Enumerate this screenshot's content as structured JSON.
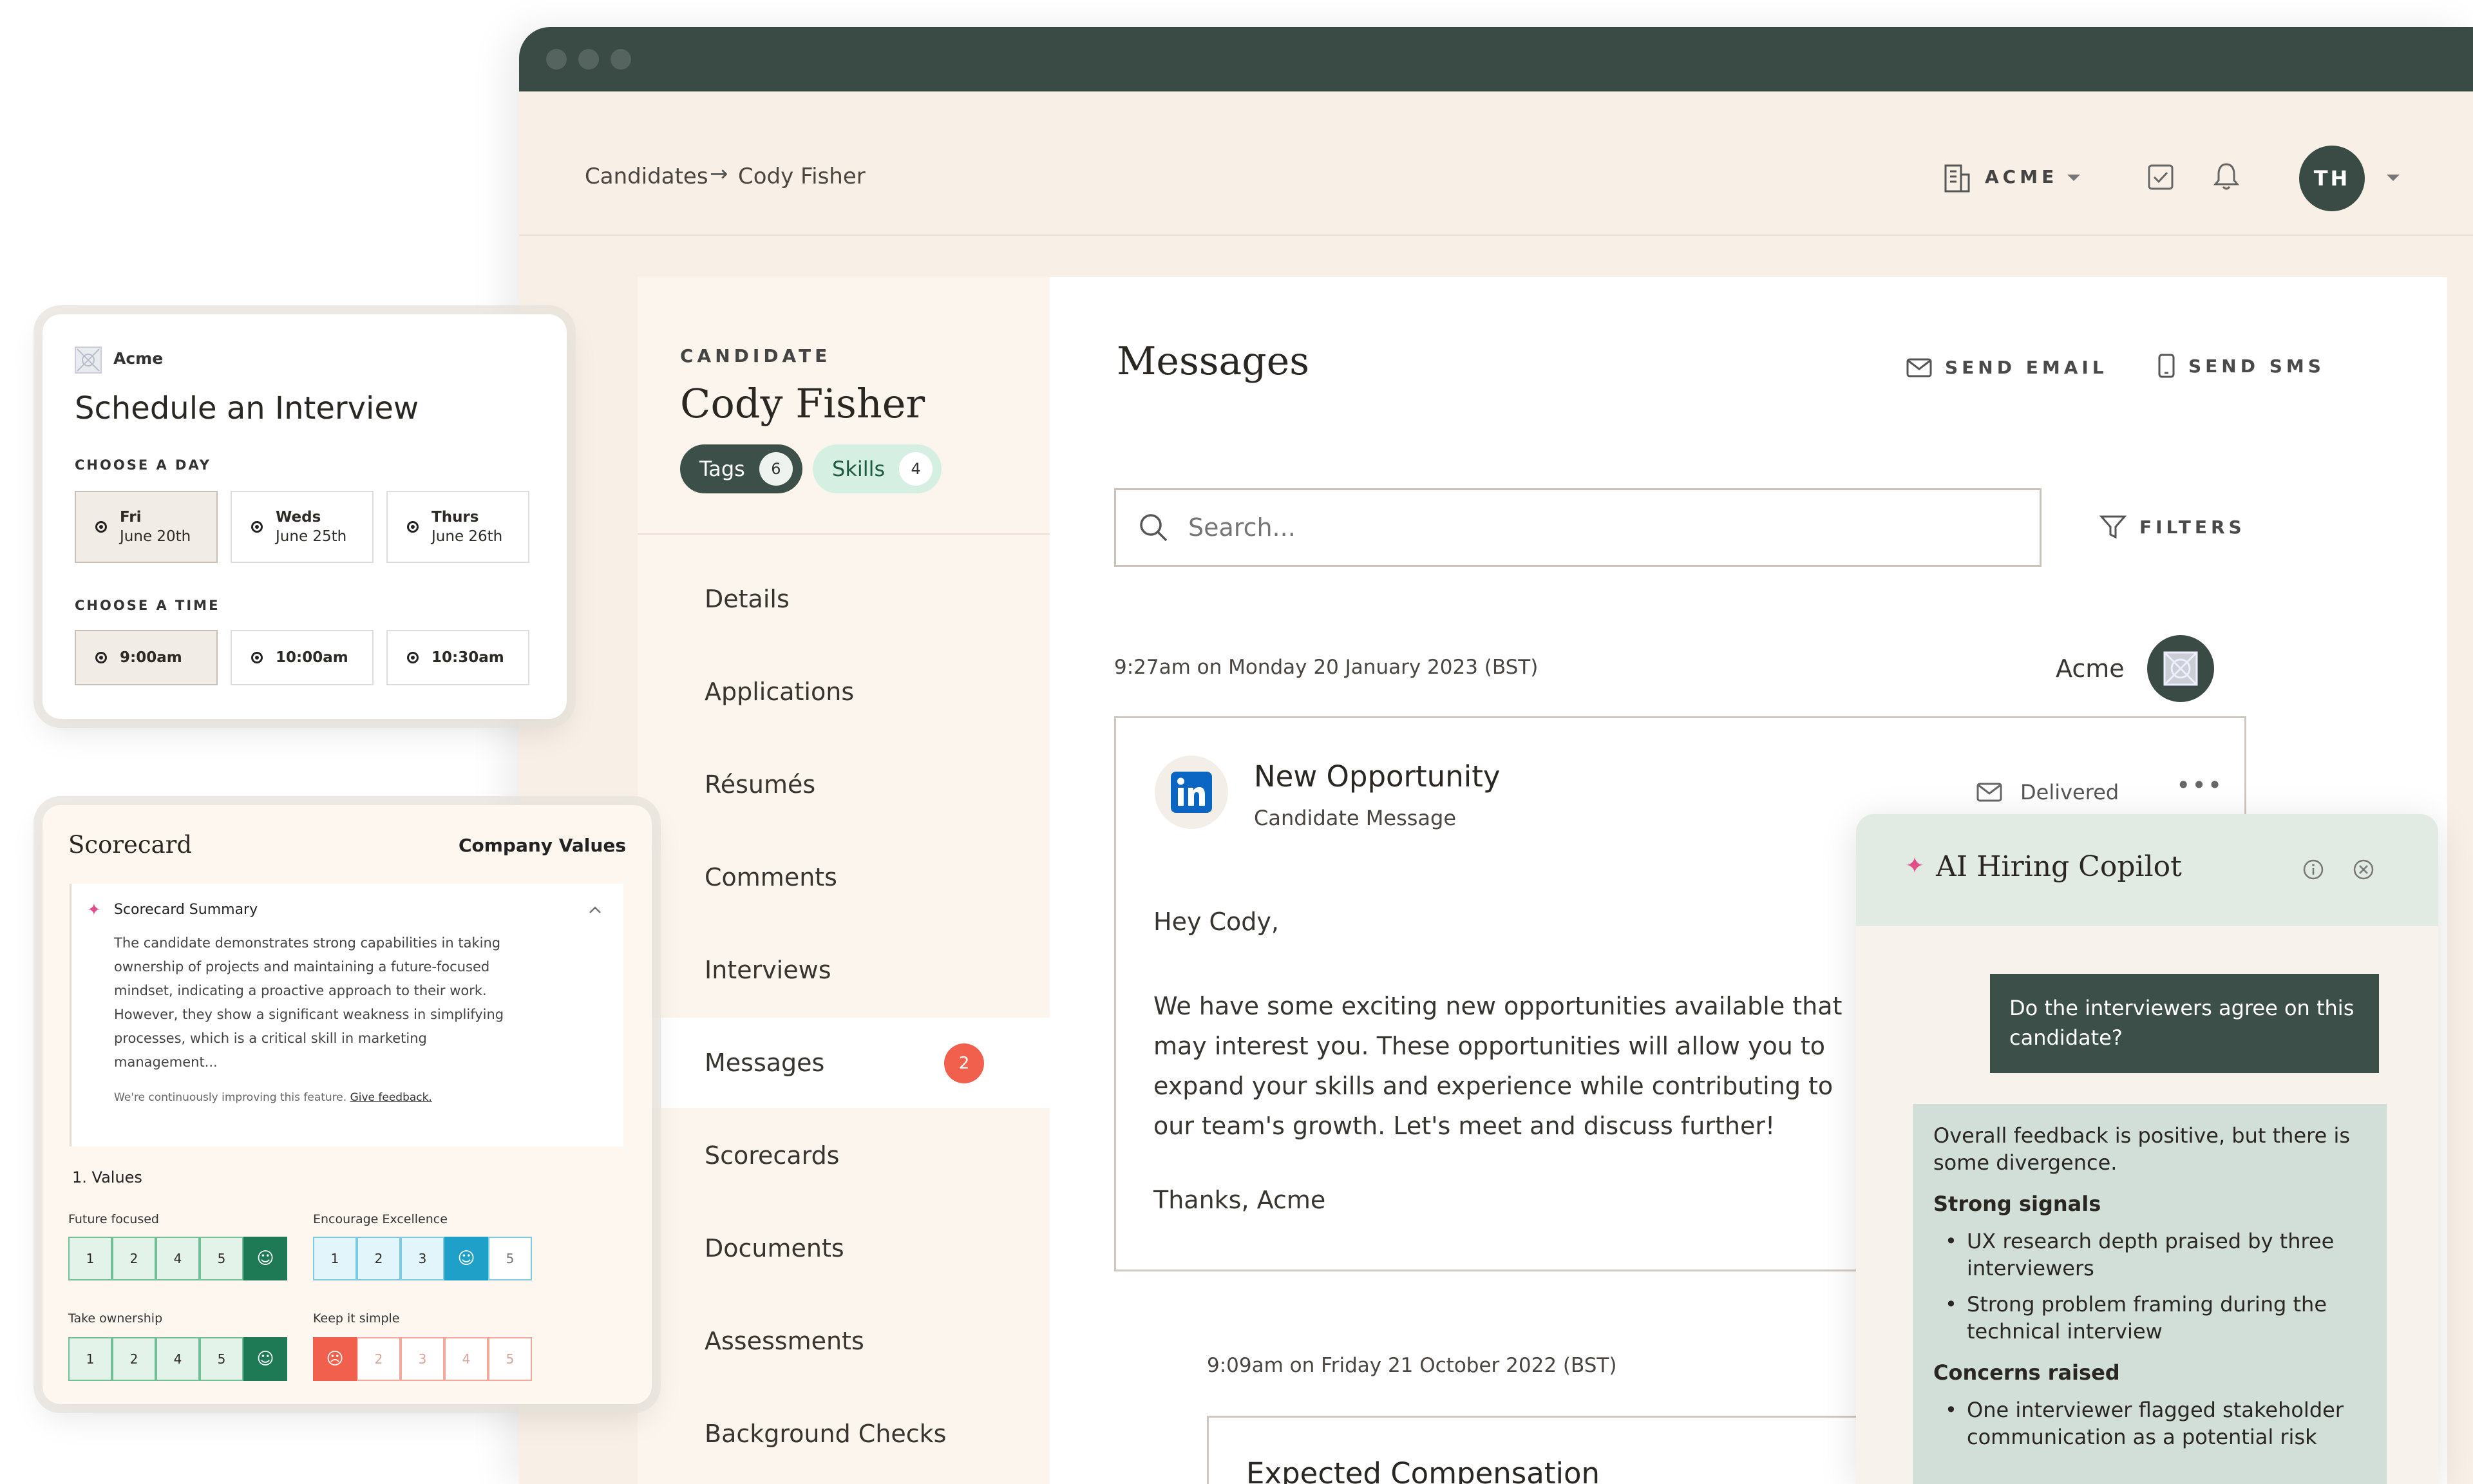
{
  "window": {
    "breadcrumb": {
      "root": "Candidates",
      "current": "Cody Fisher"
    },
    "org_label": "ACME",
    "avatar_initials": "TH"
  },
  "candidate": {
    "eyebrow": "CANDIDATE",
    "name": "Cody Fisher",
    "tags_label": "Tags",
    "tags_count": "6",
    "skills_label": "Skills",
    "skills_count": "4"
  },
  "nav": {
    "items": [
      "Details",
      "Applications",
      "Résumés",
      "Comments",
      "Interviews",
      "Messages",
      "Scorecards",
      "Documents",
      "Assessments",
      "Background Checks"
    ],
    "messages_badge": "2"
  },
  "messages": {
    "title": "Messages",
    "send_email": "SEND EMAIL",
    "send_sms": "SEND SMS",
    "search_placeholder": "Search...",
    "filters": "FILTERS",
    "thread1": {
      "timestamp": "9:27am on Monday 20 January 2023 (BST)",
      "sender": "Acme",
      "subject": "New Opportunity",
      "type": "Candidate Message",
      "status": "Delivered",
      "greeting": "Hey Cody,",
      "body_lines": [
        "We have some exciting new opportunities available that",
        "may interest you. These opportunities will allow you to",
        "expand your skills and experience while contributing to",
        "our team's growth. Let's meet and discuss further!"
      ],
      "signoff": "Thanks, Acme"
    },
    "thread2": {
      "timestamp": "9:09am on Friday 21 October 2022 (BST)",
      "subject": "Expected Compensation"
    }
  },
  "schedule": {
    "org": "Acme",
    "title": "Schedule an Interview",
    "day_label": "CHOOSE A DAY",
    "days": [
      {
        "day": "Fri",
        "date": "June 20th"
      },
      {
        "day": "Weds",
        "date": "June 25th"
      },
      {
        "day": "Thurs",
        "date": "June 26th"
      }
    ],
    "time_label": "CHOOSE A TIME",
    "times": [
      "9:00am",
      "10:00am",
      "10:30am"
    ]
  },
  "scorecard": {
    "title": "Scorecard",
    "section": "Company Values",
    "summary_title": "Scorecard Summary",
    "summary_lines": [
      "The candidate demonstrates strong capabilities in taking",
      "ownership of projects and maintaining a future-focused",
      "mindset, indicating a proactive approach to their work.",
      "However, they show a significant weakness in simplifying",
      "processes, which is a critical skill in marketing",
      "management..."
    ],
    "feedback_note": "We're continuously improving this feature.",
    "feedback_link": "Give feedback.",
    "values_heading": "1.  Values",
    "ratings": [
      {
        "label": "Future focused",
        "cells": [
          "1",
          "2",
          "4",
          "5"
        ],
        "selected": "smile"
      },
      {
        "label": "Encourage Excellence",
        "cells": [
          "1",
          "2",
          "3"
        ],
        "selected": "smile",
        "after": "5"
      },
      {
        "label": "Take ownership",
        "cells": [
          "1",
          "2",
          "4",
          "5"
        ],
        "selected": "smile"
      },
      {
        "label": "Keep it simple",
        "cells": [
          "2",
          "3",
          "4",
          "5"
        ],
        "selected": "frown"
      }
    ],
    "colors": {
      "green": "#1e7a55",
      "blue": "#1fa0c8",
      "red": "#f0604c"
    }
  },
  "copilot": {
    "title": "AI Hiring Copilot",
    "question_lines": [
      "Do the interviewers agree on this",
      "candidate?"
    ],
    "answer_intro": [
      "Overall feedback is positive, but there is",
      "some divergence."
    ],
    "strong_heading": "Strong signals",
    "strong": [
      [
        "UX research depth praised by three",
        "interviewers"
      ],
      [
        "Strong problem framing during the",
        "technical interview"
      ]
    ],
    "concerns_heading": "Concerns raised",
    "concerns": [
      [
        "One interviewer flagged stakeholder",
        "communication as a potential risk"
      ]
    ]
  }
}
